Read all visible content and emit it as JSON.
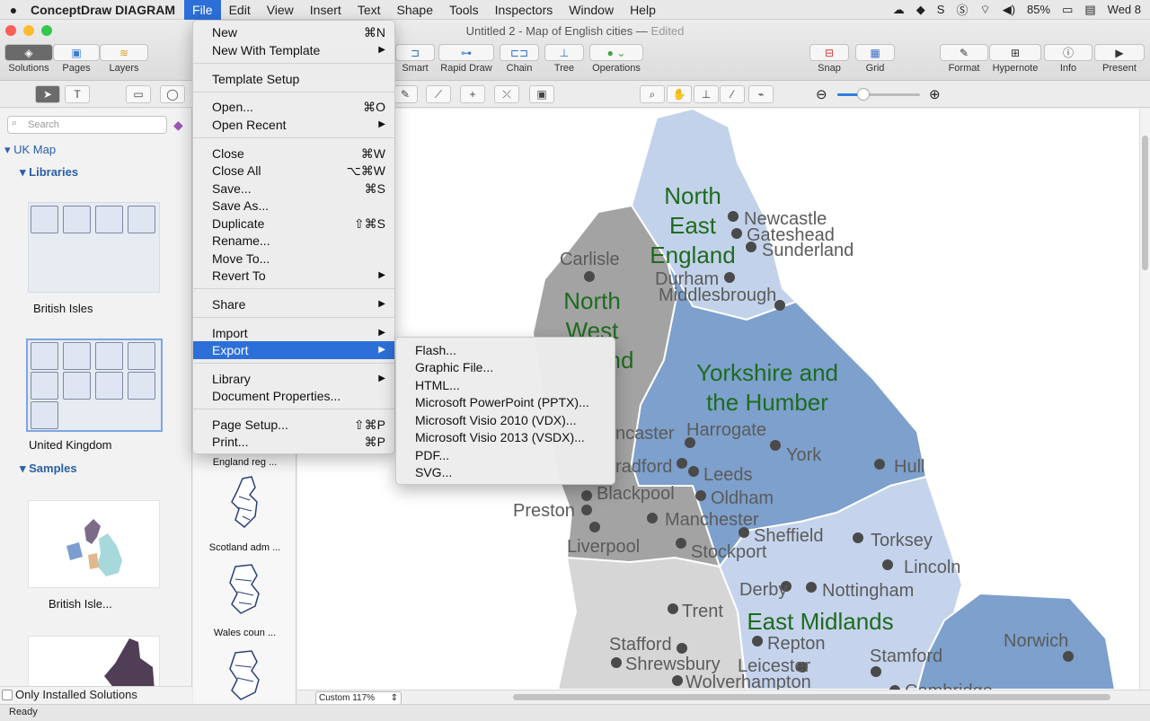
{
  "menubar": {
    "app_name": "ConceptDraw DIAGRAM",
    "items": [
      "File",
      "Edit",
      "View",
      "Insert",
      "Text",
      "Shape",
      "Tools",
      "Inspectors",
      "Window",
      "Help"
    ],
    "battery": "85%",
    "clock": "Wed 8"
  },
  "window": {
    "title": "Untitled 2 - Map of English cities",
    "title_sep": " — ",
    "edited": "Edited"
  },
  "toolbar": {
    "solutions": "Solutions",
    "pages": "Pages",
    "layers": "Layers",
    "smart": "Smart",
    "rapid_draw": "Rapid Draw",
    "chain": "Chain",
    "tree": "Tree",
    "operations": "Operations",
    "snap": "Snap",
    "grid": "Grid",
    "format": "Format",
    "hypernote": "Hypernote",
    "info": "Info",
    "present": "Present"
  },
  "sidebar": {
    "search_placeholder": "Search",
    "root": "UK Map",
    "libraries": "Libraries",
    "lib1": "British Isles",
    "lib2": "United Kingdom",
    "samples": "Samples",
    "sample1": "British Isle...",
    "only_installed": "Only Installed Solutions"
  },
  "libcol": {
    "items": [
      "England reg ...",
      "Scotland adm ...",
      "Wales coun ..."
    ]
  },
  "file_menu": {
    "new": "New",
    "new_sc": "⌘N",
    "new_template": "New With Template",
    "template_setup": "Template Setup",
    "open": "Open...",
    "open_sc": "⌘O",
    "open_recent": "Open Recent",
    "close": "Close",
    "close_sc": "⌘W",
    "close_all": "Close All",
    "close_all_sc": "⌥⌘W",
    "save": "Save...",
    "save_sc": "⌘S",
    "save_as": "Save As...",
    "duplicate": "Duplicate",
    "duplicate_sc": "⇧⌘S",
    "rename": "Rename...",
    "move_to": "Move To...",
    "revert_to": "Revert To",
    "share": "Share",
    "import": "Import",
    "export": "Export",
    "library": "Library",
    "doc_props": "Document Properties...",
    "page_setup": "Page Setup...",
    "page_setup_sc": "⇧⌘P",
    "print": "Print...",
    "print_sc": "⌘P",
    "arrow": "▶"
  },
  "export_menu": {
    "items": [
      "Flash...",
      "Graphic File...",
      "HTML...",
      "Microsoft PowerPoint (PPTX)...",
      "Microsoft Visio 2010 (VDX)...",
      "Microsoft Visio 2013 (VSDX)...",
      "PDF...",
      "SVG..."
    ]
  },
  "map": {
    "regions": {
      "north_east": [
        "North",
        "East",
        "England"
      ],
      "north_west": [
        "North",
        "West",
        "nd"
      ],
      "yorkshire": [
        "Yorkshire and",
        "the Humber"
      ],
      "east_midlands": "East Midlands"
    },
    "cities": [
      "Newcastle",
      "Gateshead",
      "Sunderland",
      "Carlisle",
      "Durham",
      "Middlesbrough",
      "Harrogate",
      "York",
      "Leeds",
      "Hull",
      "ncaster",
      "radford",
      "Blackpool",
      "Oldham",
      "Preston",
      "Manchester",
      "Sheffield",
      "Torksey",
      "Liverpool",
      "Stockport",
      "Lincoln",
      "Derby",
      "Nottingham",
      "Trent",
      "Repton",
      "Norwich",
      "Stafford",
      "Shrewsbury",
      "Leicester",
      "Stamford",
      "Wolverhampton",
      "Cambridge"
    ],
    "colors": {
      "north_east": "#c2d2ea",
      "north_west": "#a3a3a3",
      "yorkshire": "#7da0cc",
      "east_midlands": "#c5d3ec",
      "west_midlands": "#d6d6d6",
      "east": "#7da0cc",
      "region_label": "#1e6b1e",
      "city_label": "#5b5b5b",
      "dot": "#4a4a4a"
    }
  },
  "bottom": {
    "zoom": "Custom 117%",
    "status": "Ready"
  }
}
